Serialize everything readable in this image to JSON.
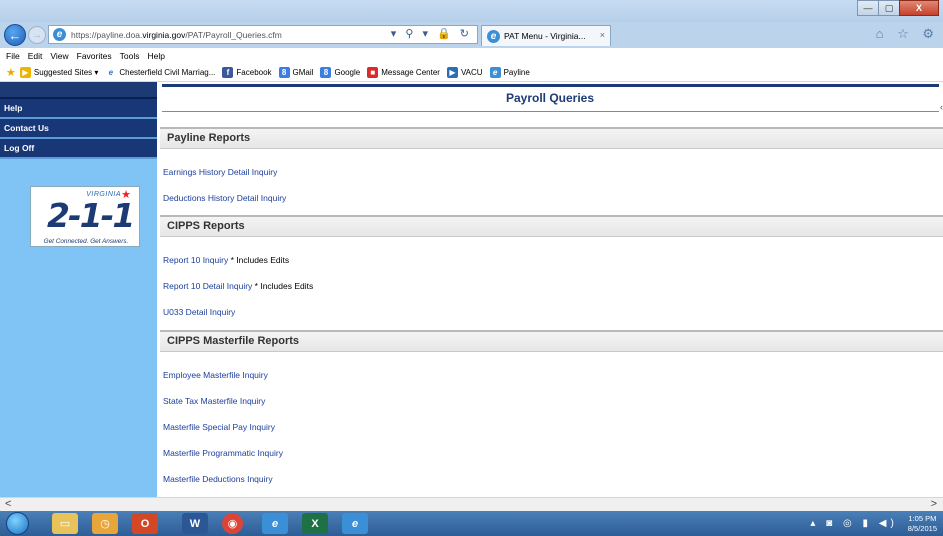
{
  "browser": {
    "url_prefix": "https://payline.doa.",
    "url_domain": "virginia.gov",
    "url_path": "/PAT/Payroll_Queries.cfm",
    "tab_title": "PAT Menu - Virginia...",
    "tab_close": "×",
    "back": "←",
    "forward": "→",
    "address_tools": "▾ ⚲ ▾ 🔒 ↻",
    "right_icons": "⌂ ☆ ⚙"
  },
  "window": {
    "minimize": "—",
    "maximize": "▢",
    "close": "X"
  },
  "menu": [
    "File",
    "Edit",
    "View",
    "Favorites",
    "Tools",
    "Help"
  ],
  "favorites": [
    {
      "label": "Suggested Sites ▾",
      "icon": "ie-suggested-icon",
      "color": "#f0b400",
      "glyph": "▶"
    },
    {
      "label": "Chesterfield Civil Marriag...",
      "icon": "ev-icon",
      "color": "#3a77c2",
      "glyph": "e"
    },
    {
      "label": "Facebook",
      "icon": "facebook-icon",
      "color": "#3b5998",
      "glyph": "f"
    },
    {
      "label": "GMail",
      "icon": "google-icon",
      "color": "#3b7de0",
      "glyph": "8"
    },
    {
      "label": "Google",
      "icon": "google-icon",
      "color": "#3b7de0",
      "glyph": "8"
    },
    {
      "label": "Message Center",
      "icon": "message-center-icon",
      "color": "#d92b2b",
      "glyph": "■"
    },
    {
      "label": "VACU",
      "icon": "vacu-icon",
      "color": "#2d6db5",
      "glyph": "▶"
    },
    {
      "label": "Payline",
      "icon": "ie-icon",
      "color": "#3b8fd6",
      "glyph": "e"
    }
  ],
  "sidebar": {
    "links": [
      "Help",
      "Contact Us",
      "Log Off"
    ],
    "logo": {
      "state": "VIRGINIA",
      "number": "2-1-1",
      "tagline": "Get Connected. Get Answers."
    }
  },
  "page": {
    "title": "Payroll Queries",
    "sections": [
      {
        "header": "Payline Reports",
        "links": [
          {
            "label": "Earnings History Detail Inquiry",
            "note": ""
          },
          {
            "label": "Deductions History Detail Inquiry",
            "note": ""
          }
        ]
      },
      {
        "header": "CIPPS Reports",
        "links": [
          {
            "label": "Report 10 Inquiry",
            "note": " * Includes Edits"
          },
          {
            "label": "Report 10 Detail Inquiry",
            "note": " * Includes Edits"
          },
          {
            "label": "U033 Detail Inquiry",
            "note": ""
          }
        ]
      },
      {
        "header": "CIPPS Masterfile Reports",
        "links": [
          {
            "label": "Employee Masterfile Inquiry",
            "note": ""
          },
          {
            "label": "State Tax Masterfile Inquiry",
            "note": ""
          },
          {
            "label": "Masterfile Special Pay Inquiry",
            "note": ""
          },
          {
            "label": "Masterfile Programmatic Inquiry",
            "note": ""
          },
          {
            "label": "Masterfile Deductions Inquiry",
            "note": ""
          }
        ]
      }
    ]
  },
  "scrollbar": {
    "left": "<",
    "right": ">"
  },
  "taskbar": {
    "apps": [
      {
        "name": "windows-explorer-icon",
        "color": "#e8c25a",
        "glyph": "▭"
      },
      {
        "name": "outlook-icon",
        "color": "#e8a53a",
        "glyph": "◷"
      },
      {
        "name": "powerpoint-icon",
        "color": "#d24726",
        "glyph": "O"
      },
      {
        "name": "word-icon",
        "color": "#2b5797",
        "glyph": "W"
      },
      {
        "name": "chrome-icon",
        "color": "#db4437",
        "glyph": "◉"
      },
      {
        "name": "ie-icon",
        "color": "#3b8fd6",
        "glyph": "e"
      },
      {
        "name": "excel-icon",
        "color": "#1e7145",
        "glyph": "X"
      },
      {
        "name": "ie-icon",
        "color": "#3b8fd6",
        "glyph": "e"
      }
    ],
    "tray_icons": "▴ ◙ ◎ ▮ ◀)",
    "time": "1:05 PM",
    "date": "8/5/2015"
  }
}
